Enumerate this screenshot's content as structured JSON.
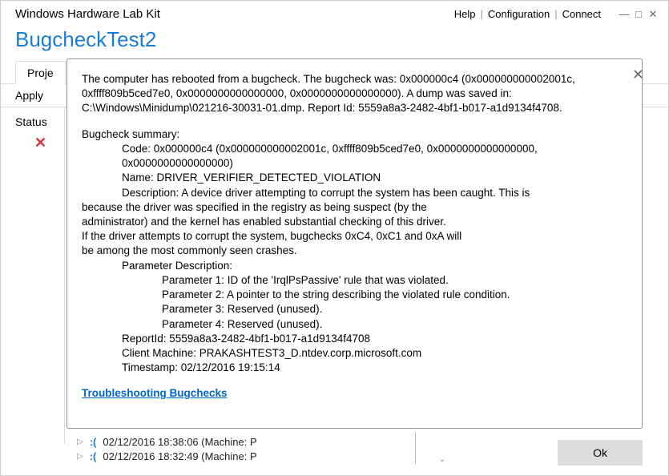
{
  "titlebar": {
    "app_name": "Windows Hardware Lab Kit",
    "help": "Help",
    "configuration": "Configuration",
    "connect": "Connect"
  },
  "page": {
    "title": "BugcheckTest2",
    "tab_projects": "Proje",
    "tab_apply": "Apply"
  },
  "sidebar": {
    "status_header": "Status",
    "status_mark": "✕"
  },
  "modal": {
    "intro": "The computer has rebooted from a bugcheck.  The bugcheck was: 0x000000c4 (0x000000000002001c, 0xffff809b5ced7e0, 0x0000000000000000, 0x0000000000000000). A dump was saved in: C:\\Windows\\Minidump\\021216-30031-01.dmp. Report Id: 5559a8a3-2482-4bf1-b017-a1d9134f4708.",
    "summary_h": "Bugcheck summary:",
    "code": "Code: 0x000000c4 (0x000000000002001c, 0xffff809b5ced7e0, 0x0000000000000000, 0x0000000000000000)",
    "name": "Name: DRIVER_VERIFIER_DETECTED_VIOLATION",
    "desc1": "Description: A device driver attempting to corrupt the system has been caught.  This is",
    "desc2": "because the driver was specified in the registry as being suspect (by the",
    "desc3": "administrator) and the kernel has enabled substantial checking of this driver.",
    "desc4": "If the driver attempts to corrupt the system, bugchecks 0xC4, 0xC1 and 0xA will",
    "desc5": "be among the most commonly seen crashes.",
    "param_h": "Parameter Description:",
    "param1": "Parameter 1: ID of the 'IrqlPsPassive' rule that was violated.",
    "param2": "Parameter 2: A pointer to the string describing the violated rule condition.",
    "param3": "Parameter 3: Reserved (unused).",
    "param4": "Parameter 4: Reserved (unused).",
    "reportid": "ReportId: 5559a8a3-2482-4bf1-b017-a1d9134f4708",
    "client": "Client Machine: PRAKASHTEST3_D.ntdev.corp.microsoft.com",
    "timestamp": "Timestamp: 02/12/2016 19:15:14",
    "troubleshoot": "Troubleshooting Bugchecks",
    "ok": "Ok"
  },
  "bg": {
    "row1": "02/12/2016 18:38:06 (Machine: P",
    "row2": "02/12/2016 18:32:49 (Machine: P"
  }
}
